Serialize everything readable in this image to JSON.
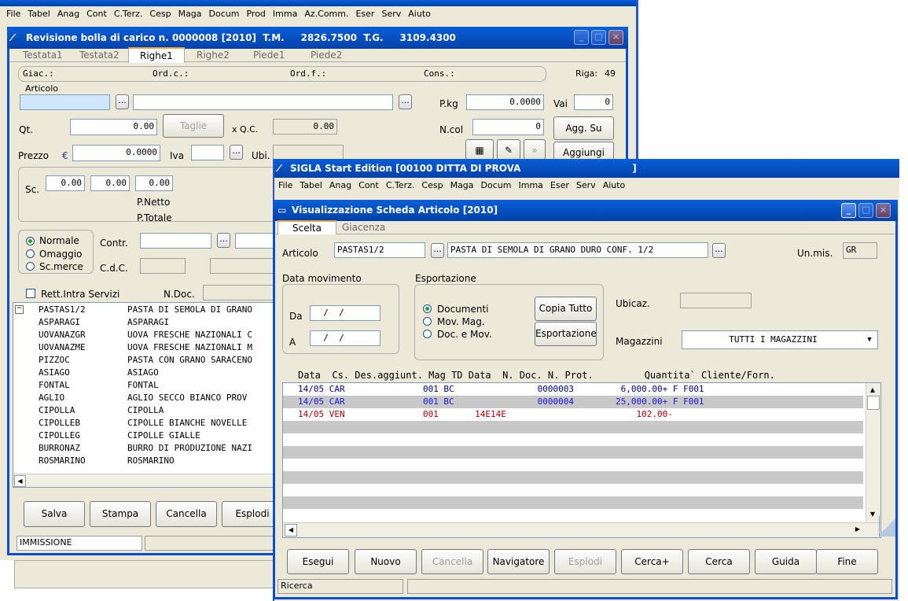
{
  "back_app": {
    "title_fragment": "SIGLA Start Edition [00100 DITTA DI PROVA",
    "menu": [
      "File",
      "Tabel",
      "Anag",
      "Cont",
      "C.Terz.",
      "Cesp",
      "Maga",
      "Docum",
      "Prod",
      "Imma",
      "Az.Comm.",
      "Eser",
      "Serv",
      "Aiuto"
    ]
  },
  "bolla": {
    "title": "Revisione bolla di carico n. 0000008 [2010]  T.M.     2826.7500  T.G.     3109.4300",
    "tabs": [
      "Testata1",
      "Testata2",
      "Righe1",
      "Righe2",
      "Piede1",
      "Piede2"
    ],
    "info_giac": "Giac.:",
    "info_ordc": "Ord.c.:",
    "info_ordf": "Ord.f.:",
    "info_cons": "Cons.:",
    "riga_label": "Riga:",
    "riga_value": "49",
    "articolo_label": "Articolo",
    "pkg_label": "P.kg",
    "pkg_value": "0.0000",
    "vai_label": "Vai",
    "vai_value": "0",
    "qt_label": "Qt.",
    "qt_value": "0.00",
    "taglie_label": "Taglie",
    "qc_label": "x  Q.C.",
    "qc_value": "0.00",
    "ncol_label": "N.col",
    "ncol_value": "0",
    "aggsu_label": "Agg. Su",
    "prezzo_label": "Prezzo",
    "euro": "€",
    "prezzo_value": "0.0000",
    "iva_label": "Iva",
    "ubi_label": "Ubi.",
    "aggiungi_label": "Aggiungi",
    "sc_label": "Sc.",
    "sc_values": [
      "0.00",
      "0.00",
      "0.00"
    ],
    "pnetto_label": "P.Netto",
    "ptotale_label": "P.Totale",
    "radio_normale": "Normale",
    "radio_omaggio": "Omaggio",
    "radio_scmerce": "Sc.merce",
    "contr_label": "Contr.",
    "cdc_label": "C.d.C.",
    "rett_label": "Rett.Intra Servizi",
    "ndoc_label": "N.Doc.",
    "items": [
      {
        "code": "PASTAS1/2",
        "desc": "PASTA DI SEMOLA DI GRANO"
      },
      {
        "code": "ASPARAGI",
        "desc": "ASPARAGI"
      },
      {
        "code": "UOVANAZGR",
        "desc": "UOVA FRESCHE NAZIONALI C"
      },
      {
        "code": "UOVANAZME",
        "desc": "UOVA FRESCHE NAZIONALI M"
      },
      {
        "code": "PIZZOC",
        "desc": "PASTA CON GRANO SARACENO"
      },
      {
        "code": "ASIAGO",
        "desc": "ASIAGO"
      },
      {
        "code": "FONTAL",
        "desc": "FONTAL"
      },
      {
        "code": "AGLIO",
        "desc": "AGLIO SECCO BIANCO PROV"
      },
      {
        "code": "CIPOLLA",
        "desc": "CIPOLLA"
      },
      {
        "code": "CIPOLLEB",
        "desc": "CIPOLLE BIANCHE NOVELLE"
      },
      {
        "code": "CIPOLLEG",
        "desc": "CIPOLLE GIALLE"
      },
      {
        "code": "BURRONAZ",
        "desc": "BURRO DI PRODUZIONE NAZI"
      },
      {
        "code": "ROSMARINO",
        "desc": "ROSMARINO"
      }
    ],
    "buttons": {
      "salva": "Salva",
      "stampa": "Stampa",
      "cancella": "Cancella",
      "esplodi": "Esplodi"
    },
    "status": "IMMISSIONE"
  },
  "front_app": {
    "title": "SIGLA Start Edition [00100 DITTA DI PROVA                                  ]",
    "menu": [
      "File",
      "Tabel",
      "Anag",
      "Cont",
      "C.Terz.",
      "Cesp",
      "Maga",
      "Docum",
      "Imma",
      "Eser",
      "Serv",
      "Aiuto"
    ]
  },
  "scheda": {
    "title": "Visualizzazione Scheda Articolo [2010]",
    "tab_scelta": "Scelta",
    "tab_giacenza": "Giacenza",
    "articolo_label": "Articolo",
    "articolo_code": "PASTAS1/2",
    "articolo_desc": "PASTA DI SEMOLA DI GRANO DURO CONF. 1/2",
    "unmis_label": "Un.mis.",
    "unmis_value": "GR",
    "data_mov_label": "Data movimento",
    "da_label": "Da",
    "a_label": "A",
    "date_placeholder": "  /  /",
    "esport_label": "Esportazione",
    "radio_documenti": "Documenti",
    "radio_movmag": "Mov. Mag.",
    "radio_docmov": "Doc. e Mov.",
    "copia_tutto": "Copia Tutto",
    "esportazione_btn": "Esportazione",
    "ubicaz_label": "Ubicaz.",
    "magazzini_label": "Magazzini",
    "magazzini_value": "TUTTI I MAGAZZINI",
    "grid_header": "Data  Cs. Des.aggiunt. Mag TD Data  N. Doc. N. Prot.         Quantita` Cliente/Forn.",
    "rows": [
      {
        "text": "14/05 CAR               001 BC                0000003         6,000.00+ F F001",
        "color": "#000080"
      },
      {
        "text": "14/05 CAR               001 BC                0000004        25,000.00+ F F001",
        "color": "#1a1ad0"
      },
      {
        "text": "14/05 VEN               001       14E14E                         102.00-",
        "color": "#b00000"
      }
    ],
    "buttons": {
      "esegui": "Esegui",
      "nuovo": "Nuovo",
      "cancella": "Cancella",
      "navigatore": "Navigatore",
      "esplodi": "Esplodi",
      "cerca_plus": "Cerca+",
      "cerca": "Cerca",
      "guida": "Guida",
      "fine": "Fine"
    },
    "status": "Ricerca"
  }
}
